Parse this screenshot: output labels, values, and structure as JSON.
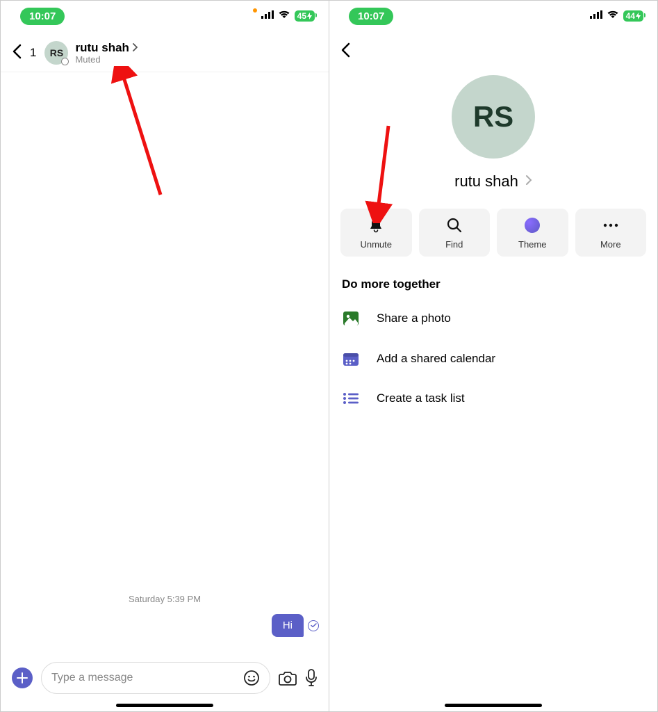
{
  "left": {
    "status": {
      "time": "10:07",
      "battery": "45"
    },
    "chat": {
      "back_count": "1",
      "avatar_initials": "RS",
      "title": "rutu shah",
      "subtitle": "Muted",
      "timestamp": "Saturday 5:39 PM",
      "message_text": "Hi",
      "composer_placeholder": "Type a message"
    }
  },
  "right": {
    "status": {
      "time": "10:07",
      "battery": "44"
    },
    "profile": {
      "avatar_initials": "RS",
      "name": "rutu shah",
      "actions": {
        "unmute": "Unmute",
        "find": "Find",
        "theme": "Theme",
        "more": "More"
      },
      "section_title": "Do more together",
      "options": {
        "share_photo": "Share a photo",
        "shared_calendar": "Add a shared calendar",
        "task_list": "Create a task list"
      }
    }
  }
}
